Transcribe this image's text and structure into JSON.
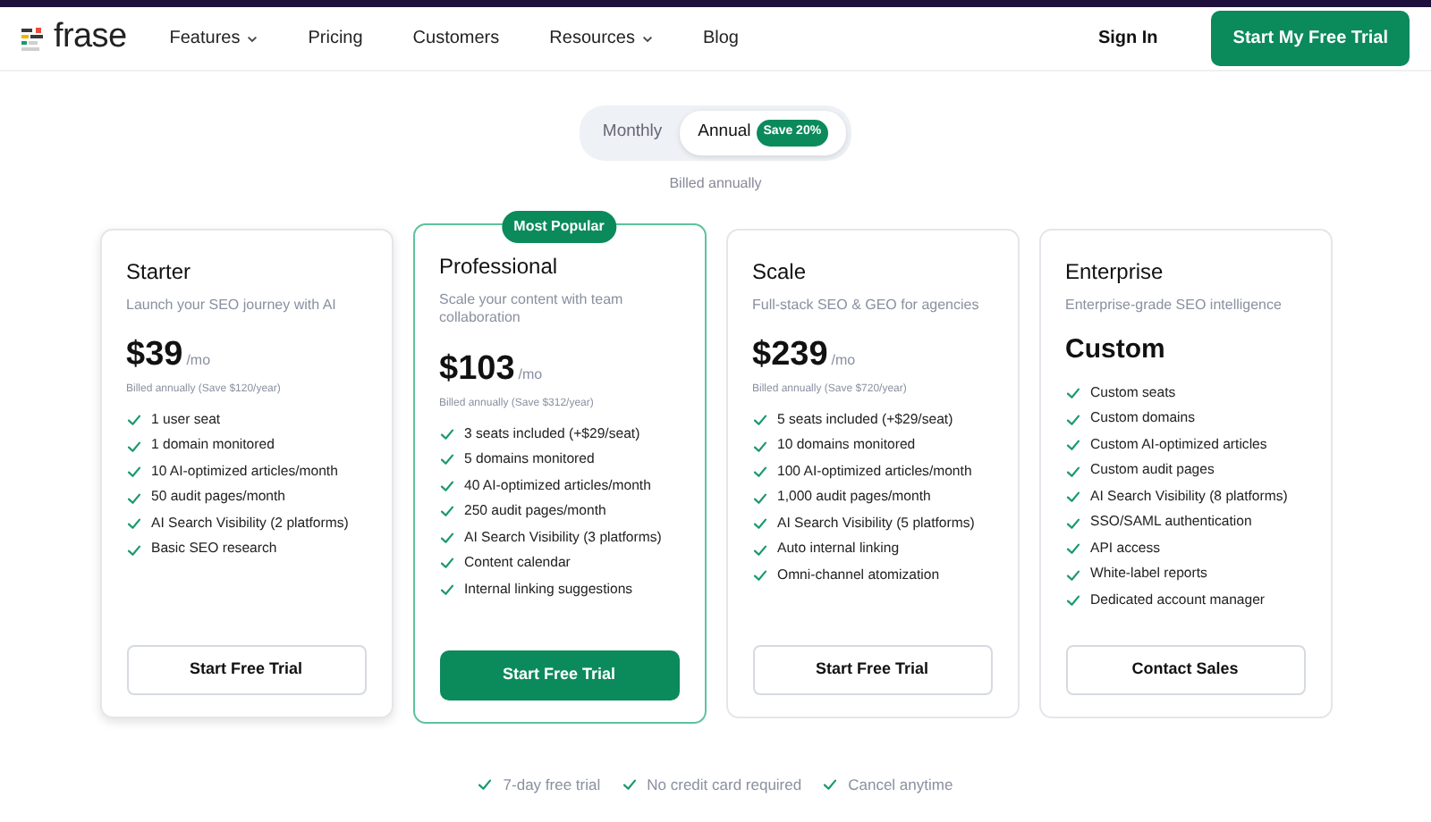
{
  "nav": {
    "logo": "frase",
    "links": [
      {
        "label": "Features",
        "dropdown": true
      },
      {
        "label": "Pricing",
        "dropdown": false
      },
      {
        "label": "Customers",
        "dropdown": false
      },
      {
        "label": "Resources",
        "dropdown": true
      },
      {
        "label": "Blog",
        "dropdown": false
      }
    ],
    "sign_in": "Sign In",
    "cta": "Start My Free Trial"
  },
  "billing_toggle": {
    "options": [
      {
        "label": "Monthly",
        "selected": false
      },
      {
        "label": "Annual",
        "selected": true,
        "badge": "Save 20%"
      }
    ],
    "note": "Billed annually"
  },
  "plans": [
    {
      "name": "Starter",
      "tagline": "Launch your SEO journey with AI",
      "kind": "amount",
      "price": "$39",
      "period": "/mo",
      "billing": "Billed annually (Save $120/year)",
      "featured": false,
      "features": [
        "1 user seat",
        "1 domain monitored",
        "10 AI-optimized articles/month",
        "50 audit pages/month",
        "AI Search Visibility (2 platforms)",
        "Basic SEO research"
      ],
      "button": "Start Free Trial"
    },
    {
      "name": "Professional",
      "ribbon": "Most Popular",
      "tagline": "Scale your content with team collaboration",
      "kind": "amount",
      "price": "$103",
      "period": "/mo",
      "billing": "Billed annually (Save $312/year)",
      "featured": true,
      "features": [
        "3 seats included (+$29/seat)",
        "5 domains monitored",
        "40 AI-optimized articles/month",
        "250 audit pages/month",
        "AI Search Visibility (3 platforms)",
        "Content calendar",
        "Internal linking suggestions"
      ],
      "button": "Start Free Trial"
    },
    {
      "name": "Scale",
      "tagline": "Full-stack SEO & GEO for agencies",
      "kind": "amount",
      "price": "$239",
      "period": "/mo",
      "billing": "Billed annually (Save $720/year)",
      "featured": false,
      "features": [
        "5 seats included (+$29/seat)",
        "10 domains monitored",
        "100 AI-optimized articles/month",
        "1,000 audit pages/month",
        "AI Search Visibility (5 platforms)",
        "Auto internal linking",
        "Omni-channel atomization"
      ],
      "button": "Start Free Trial"
    },
    {
      "name": "Enterprise",
      "tagline": "Enterprise-grade SEO intelligence",
      "kind": "custom",
      "price": "Custom",
      "featured": false,
      "features": [
        "Custom seats",
        "Custom domains",
        "Custom AI-optimized articles",
        "Custom audit pages",
        "AI Search Visibility (8 platforms)",
        "SSO/SAML authentication",
        "API access",
        "White-label reports",
        "Dedicated account manager"
      ],
      "button": "Contact Sales"
    }
  ],
  "guarantees": [
    "7-day free trial",
    "No credit card required",
    "Cancel anytime"
  ]
}
